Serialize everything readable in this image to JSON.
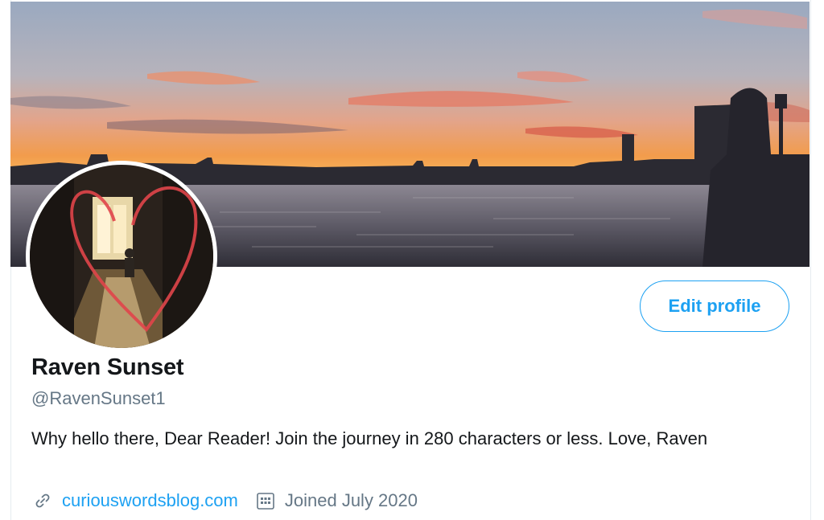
{
  "profile": {
    "display_name": "Raven Sunset",
    "handle": "@RavenSunset1",
    "bio": "Why hello there, Dear Reader! Join the journey in 280 characters or less. Love, Raven",
    "website": "curiouswordsblog.com",
    "joined": "Joined July 2020",
    "edit_label": "Edit profile"
  },
  "icons": {
    "link": "link-icon",
    "calendar": "calendar-icon"
  },
  "colors": {
    "accent": "#1da1f2",
    "secondary_text": "#657786",
    "primary_text": "#14171a"
  }
}
